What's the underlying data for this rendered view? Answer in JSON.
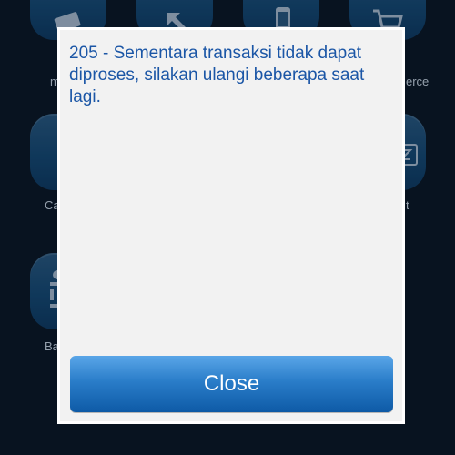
{
  "dialog": {
    "message": "205 - Sementara transaksi tidak dapat diproses, silakan ulangi beberapa saat lagi.",
    "close_label": "Close"
  },
  "background_labels": {
    "left_row1": "m",
    "right_row1": "erce",
    "left_row2": "Ca",
    "right_row2": "t",
    "left_row3": "Ba"
  },
  "colors": {
    "app_background": "#0b1a2b",
    "dialog_background": "#f2f2f2",
    "message_text": "#1b56a6",
    "button_top": "#5aa6e8",
    "button_bottom": "#0e5aa6"
  },
  "icons": [
    "money-icon",
    "arrow-icon",
    "mobile-pay-icon",
    "cart-icon",
    "card-icon",
    "bank-icon"
  ]
}
